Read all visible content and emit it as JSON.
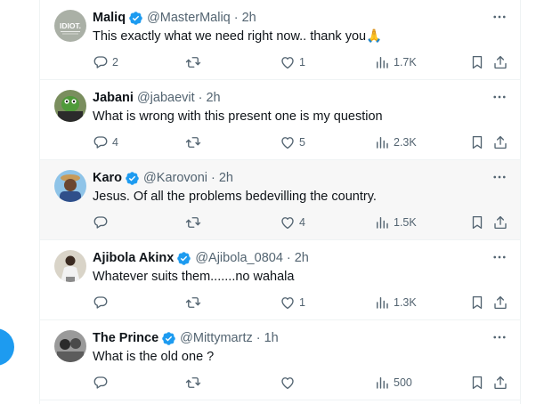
{
  "replies": [
    {
      "name": "Maliq",
      "handle": "@MasterMaliq",
      "time": "2h",
      "text": "This exactly what we need right now.. thank you🙏",
      "reply_count": "2",
      "retweet_count": "",
      "like_count": "1",
      "views": "1.7K",
      "avatar": {
        "label": "IDIOT."
      }
    },
    {
      "name": "Jabani",
      "handle": "@jabaevit",
      "time": "2h",
      "text": "What is wrong with this present one is my question",
      "reply_count": "4",
      "retweet_count": "",
      "like_count": "5",
      "views": "2.3K"
    },
    {
      "name": "Karo",
      "handle": "@Karovoni",
      "time": "2h",
      "text": "Jesus. Of all the problems bedevilling the country.",
      "reply_count": "",
      "retweet_count": "",
      "like_count": "4",
      "views": "1.5K"
    },
    {
      "name": "Ajibola Akinx",
      "handle": "@Ajibola_0804",
      "time": "2h",
      "text": "Whatever suits them.......no wahala",
      "reply_count": "",
      "retweet_count": "",
      "like_count": "1",
      "views": "1.3K"
    },
    {
      "name": "The Prince",
      "handle": "@Mittymartz",
      "time": "1h",
      "text": "What is the old one ?",
      "reply_count": "",
      "retweet_count": "",
      "like_count": "",
      "views": "500"
    }
  ],
  "separator": "·",
  "colors": {
    "accent": "#1d9bf0",
    "text_primary": "#0f1419",
    "text_secondary": "#536471",
    "border": "#eff3f4",
    "hover_bg": "#f7f7f7"
  },
  "icons": [
    "verified-badge-icon",
    "more-icon",
    "reply-icon",
    "retweet-icon",
    "like-icon",
    "views-icon",
    "bookmark-icon",
    "share-icon"
  ]
}
